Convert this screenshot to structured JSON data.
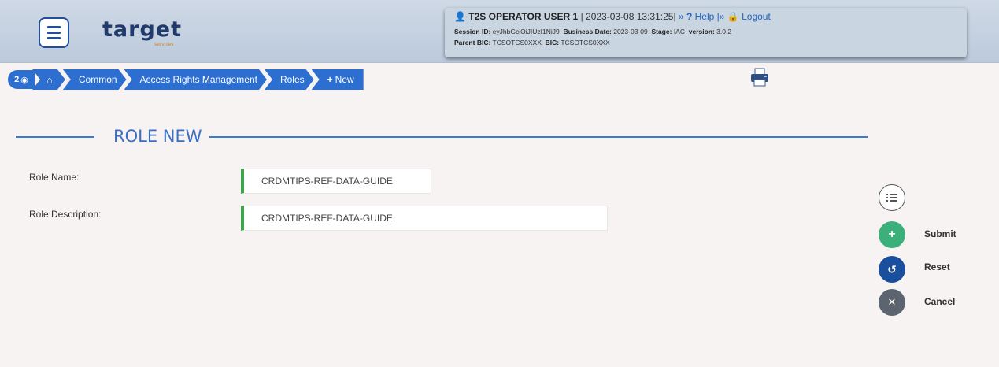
{
  "header": {
    "logo": "target",
    "logo_sub": "services",
    "user": "T2S OPERATOR USER 1",
    "datetime": "| 2023-03-08 13:31:25|",
    "sep1": "»",
    "help": "Help",
    "sep2": "|»",
    "logout": "Logout",
    "session_label": "Session ID:",
    "session_value": "eyJhbGciOiJIUzI1NiJ9",
    "business_date_label": "Business Date:",
    "business_date_value": "2023-03-09",
    "stage_label": "Stage:",
    "stage_value": "IAC",
    "version_label": "version:",
    "version_value": "3.0.2",
    "parent_bic_label": "Parent BIC:",
    "parent_bic_value": "TCSOTCS0XXX",
    "bic_label": "BIC:",
    "bic_value": "TCSOTCS0XXX"
  },
  "breadcrumb": {
    "badge_count": "2",
    "items": [
      "Common",
      "Access Rights Management",
      "Roles",
      "New"
    ],
    "new_prefix": "+"
  },
  "section": {
    "title": "ROLE NEW"
  },
  "form": {
    "role_name_label": "Role Name:",
    "role_name_value": "CRDMTIPS-REF-DATA-GUIDE",
    "role_desc_label": "Role Description:",
    "role_desc_value": "CRDMTIPS-REF-DATA-GUIDE"
  },
  "actions": {
    "submit": "Submit",
    "reset": "Reset",
    "cancel": "Cancel"
  },
  "colors": {
    "accent": "#2d6fd0",
    "submit": "#3cb07a",
    "reset": "#1a4f9e",
    "cancel": "#5c6470",
    "field_marker": "#3aa84a"
  }
}
